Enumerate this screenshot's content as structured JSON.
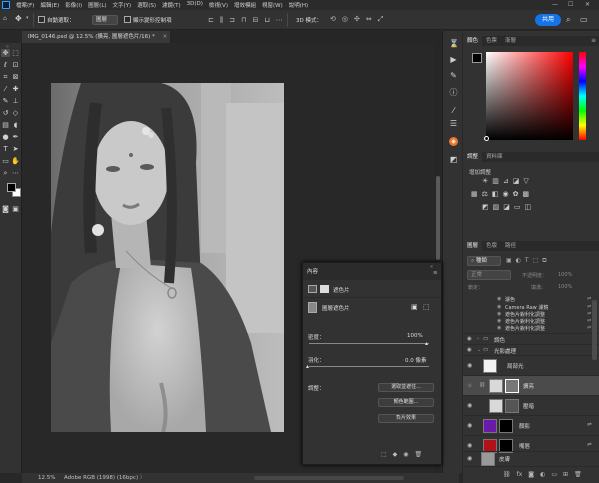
{
  "menu": {
    "items": [
      "檔案(F)",
      "編輯(E)",
      "影像(I)",
      "圖層(L)",
      "文字(Y)",
      "選取(S)",
      "濾鏡(T)",
      "3D(D)",
      "檢視(V)",
      "增效模組",
      "視窗(W)",
      "說明(H)"
    ],
    "win_controls": [
      "—",
      "☐",
      "✕"
    ]
  },
  "options": {
    "auto_select_label": "自動選取：",
    "auto_select_value": "圖層",
    "transform_label": "顯示變形控制項",
    "mode_3d": "3D 模式：",
    "share": "共用"
  },
  "document": {
    "tab_title": "IMG_0146.psd @ 12.5% (擴亮, 圖層遮色片/16) *",
    "tab_close": "✕"
  },
  "status": {
    "zoom": "12.5%",
    "profile": "Adobe RGB (1998) (16bpc)"
  },
  "color_panel": {
    "tabs": [
      "顏色",
      "色票",
      "漸層"
    ],
    "fg": "#000000",
    "bg": "#ffffff"
  },
  "adjust_panel": {
    "tabs": [
      "調整",
      "資料庫"
    ],
    "title": "增加調整"
  },
  "layers_panel": {
    "tabs": [
      "圖層",
      "色版",
      "路徑"
    ],
    "kind": "種類",
    "blend_mode": "正常",
    "opacity_label": "不透明度：",
    "opacity": "100%",
    "lock_label": "鎖定：",
    "fill_label": "填滿：",
    "fill": "100%",
    "filter_items": [
      {
        "name": "濾色"
      },
      {
        "name": "Camera Raw 濾鏡"
      },
      {
        "name": "遮色片銳利化調整"
      },
      {
        "name": "遮色片銳利化調整"
      },
      {
        "name": "遮色片銳利化調整"
      }
    ],
    "layers": [
      {
        "name": "調色",
        "type": "group"
      },
      {
        "name": "光影處理",
        "type": "group"
      },
      {
        "name": "局部光",
        "type": "layer"
      },
      {
        "name": "擴亮",
        "type": "layer"
      },
      {
        "name": "壓暗",
        "type": "layer"
      },
      {
        "name": "顏影",
        "type": "layer"
      },
      {
        "name": "嘴唇",
        "type": "layer"
      },
      {
        "name": "皮膚",
        "type": "layer"
      }
    ],
    "colors": {
      "purple": "#6a1aa8",
      "red": "#b3101a",
      "selected": "#4b4b4b"
    }
  },
  "properties": {
    "tab": "內容",
    "head_label": "遮色片",
    "mask_label": "圖層遮色片",
    "density_label": "密度：",
    "density": "100%",
    "feather_label": "羽化：",
    "feather": "0.0 像素",
    "refine_label": "調整：",
    "buttons": [
      "選取並遮住...",
      "顏色範圍...",
      "負片效果"
    ]
  }
}
